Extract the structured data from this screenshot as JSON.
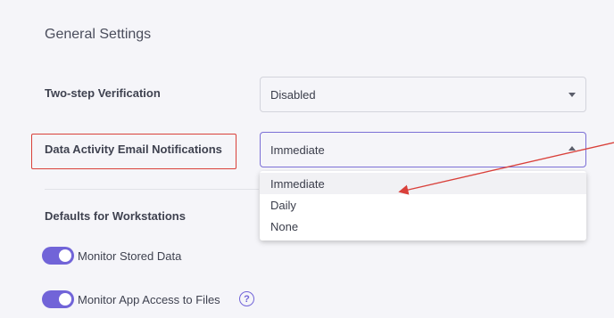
{
  "general_settings": {
    "title": "General Settings",
    "two_step": {
      "label": "Two-step Verification",
      "value": "Disabled"
    },
    "data_activity": {
      "label": "Data Activity Email Notifications",
      "value": "Immediate",
      "options": [
        "Immediate",
        "Daily",
        "None"
      ]
    }
  },
  "defaults": {
    "title": "Defaults for Workstations",
    "toggles": [
      {
        "label": "Monitor Stored Data",
        "on": true
      },
      {
        "label": "Monitor App Access to Files",
        "on": true
      }
    ],
    "help_icon": "?"
  },
  "colors": {
    "accent": "#7164d8",
    "annotation": "#d9403a",
    "background": "#f5f5f9"
  },
  "icons": [
    "chevron-down-icon",
    "chevron-up-icon",
    "help-icon"
  ]
}
